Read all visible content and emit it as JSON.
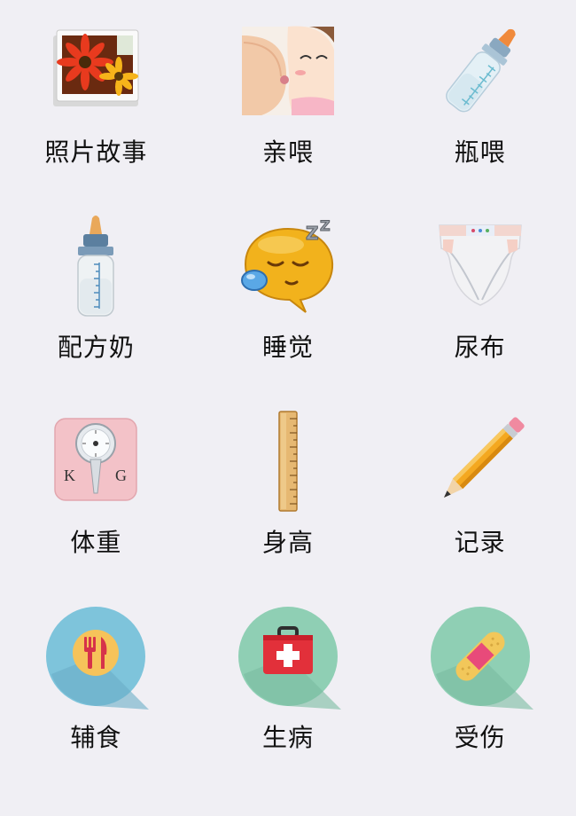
{
  "tiles": [
    {
      "label": "照片故事",
      "icon": "photo-icon"
    },
    {
      "label": "亲喂",
      "icon": "breastfeeding-icon"
    },
    {
      "label": "瓶喂",
      "icon": "bottle-icon"
    },
    {
      "label": "配方奶",
      "icon": "formula-bottle-icon"
    },
    {
      "label": "睡觉",
      "icon": "sleep-icon"
    },
    {
      "label": "尿布",
      "icon": "diaper-icon"
    },
    {
      "label": "体重",
      "icon": "scale-icon"
    },
    {
      "label": "身高",
      "icon": "ruler-icon"
    },
    {
      "label": "记录",
      "icon": "pencil-icon"
    },
    {
      "label": "辅食",
      "icon": "food-icon"
    },
    {
      "label": "生病",
      "icon": "first-aid-icon"
    },
    {
      "label": "受伤",
      "icon": "bandage-icon"
    }
  ],
  "colors": {
    "background": "#f0eff4",
    "food_circle": "#7ec4db",
    "sick_circle": "#8fcfb4",
    "injury_circle": "#8fcfb4"
  }
}
